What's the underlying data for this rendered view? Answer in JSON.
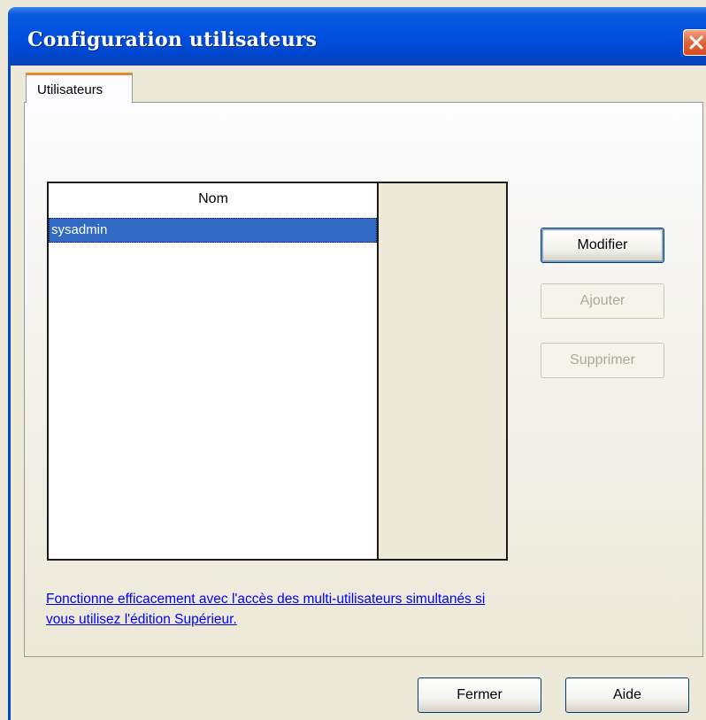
{
  "window": {
    "title": "Configuration utilisateurs"
  },
  "tabs": [
    {
      "label": "Utilisateurs"
    }
  ],
  "users_list": {
    "columns": [
      "Nom"
    ],
    "rows": [
      {
        "name": "sysadmin",
        "selected": true
      }
    ]
  },
  "actions": {
    "modify_label": "Modifier",
    "add_label": "Ajouter",
    "delete_label": "Supprimer"
  },
  "info_link": {
    "line1": "Fonctionne efficacement avec l'accès des multi-utilisateurs simultanés si",
    "line2": "vous utilisez l'édition Supérieur."
  },
  "footer": {
    "close_label": "Fermer",
    "help_label": "Aide"
  },
  "colors": {
    "titlebar": "#0050e0",
    "selection": "#316ac5",
    "tab_highlight": "#e68b2c",
    "close_button": "#d64a1c",
    "link": "#0000ff"
  }
}
